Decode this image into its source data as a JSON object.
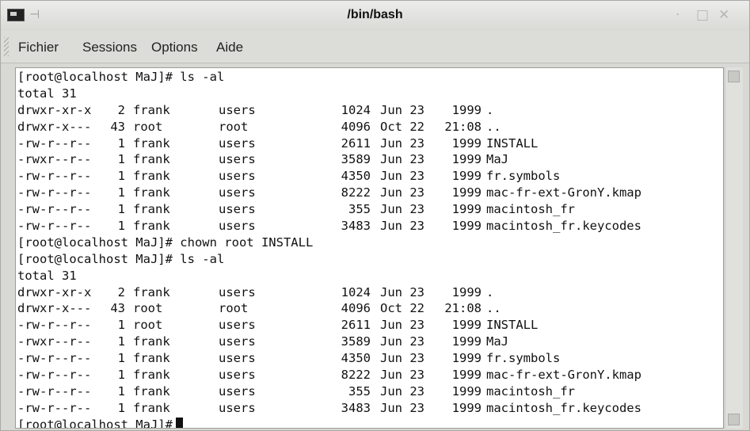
{
  "window": {
    "title": "/bin/bash",
    "icons": [
      "terminal-icon",
      "pin-icon",
      "minimize-icon",
      "maximize-icon",
      "close-icon"
    ]
  },
  "menu": {
    "items": [
      "Fichier",
      "Sessions",
      "Options",
      "Aide"
    ]
  },
  "terminal": {
    "prompt1": "[root@localhost MaJ]# ls -al",
    "total1": "total 31",
    "listing1": [
      {
        "perm": "drwxr-xr-x",
        "links": "2",
        "owner": "frank",
        "group": "users",
        "size": "1024",
        "date": "Jun 23",
        "time": "1999",
        "name": "."
      },
      {
        "perm": "drwxr-x---",
        "links": "43",
        "owner": "root",
        "group": "root",
        "size": "4096",
        "date": "Oct 22",
        "time": "21:08",
        "name": ".."
      },
      {
        "perm": "-rw-r--r--",
        "links": "1",
        "owner": "frank",
        "group": "users",
        "size": "2611",
        "date": "Jun 23",
        "time": "1999",
        "name": "INSTALL"
      },
      {
        "perm": "-rwxr--r--",
        "links": "1",
        "owner": "frank",
        "group": "users",
        "size": "3589",
        "date": "Jun 23",
        "time": "1999",
        "name": "MaJ"
      },
      {
        "perm": "-rw-r--r--",
        "links": "1",
        "owner": "frank",
        "group": "users",
        "size": "4350",
        "date": "Jun 23",
        "time": "1999",
        "name": "fr.symbols"
      },
      {
        "perm": "-rw-r--r--",
        "links": "1",
        "owner": "frank",
        "group": "users",
        "size": "8222",
        "date": "Jun 23",
        "time": "1999",
        "name": "mac-fr-ext-GronY.kmap"
      },
      {
        "perm": "-rw-r--r--",
        "links": "1",
        "owner": "frank",
        "group": "users",
        "size": "355",
        "date": "Jun 23",
        "time": "1999",
        "name": "macintosh_fr"
      },
      {
        "perm": "-rw-r--r--",
        "links": "1",
        "owner": "frank",
        "group": "users",
        "size": "3483",
        "date": "Jun 23",
        "time": "1999",
        "name": "macintosh_fr.keycodes"
      }
    ],
    "prompt2": "[root@localhost MaJ]# chown root INSTALL",
    "prompt3": "[root@localhost MaJ]# ls -al",
    "total2": "total 31",
    "listing2": [
      {
        "perm": "drwxr-xr-x",
        "links": "2",
        "owner": "frank",
        "group": "users",
        "size": "1024",
        "date": "Jun 23",
        "time": "1999",
        "name": "."
      },
      {
        "perm": "drwxr-x---",
        "links": "43",
        "owner": "root",
        "group": "root",
        "size": "4096",
        "date": "Oct 22",
        "time": "21:08",
        "name": ".."
      },
      {
        "perm": "-rw-r--r--",
        "links": "1",
        "owner": "root",
        "group": "users",
        "size": "2611",
        "date": "Jun 23",
        "time": "1999",
        "name": "INSTALL"
      },
      {
        "perm": "-rwxr--r--",
        "links": "1",
        "owner": "frank",
        "group": "users",
        "size": "3589",
        "date": "Jun 23",
        "time": "1999",
        "name": "MaJ"
      },
      {
        "perm": "-rw-r--r--",
        "links": "1",
        "owner": "frank",
        "group": "users",
        "size": "4350",
        "date": "Jun 23",
        "time": "1999",
        "name": "fr.symbols"
      },
      {
        "perm": "-rw-r--r--",
        "links": "1",
        "owner": "frank",
        "group": "users",
        "size": "8222",
        "date": "Jun 23",
        "time": "1999",
        "name": "mac-fr-ext-GronY.kmap"
      },
      {
        "perm": "-rw-r--r--",
        "links": "1",
        "owner": "frank",
        "group": "users",
        "size": "355",
        "date": "Jun 23",
        "time": "1999",
        "name": "macintosh_fr"
      },
      {
        "perm": "-rw-r--r--",
        "links": "1",
        "owner": "frank",
        "group": "users",
        "size": "3483",
        "date": "Jun 23",
        "time": "1999",
        "name": "macintosh_fr.keycodes"
      }
    ],
    "prompt4": "[root@localhost MaJ]#"
  }
}
